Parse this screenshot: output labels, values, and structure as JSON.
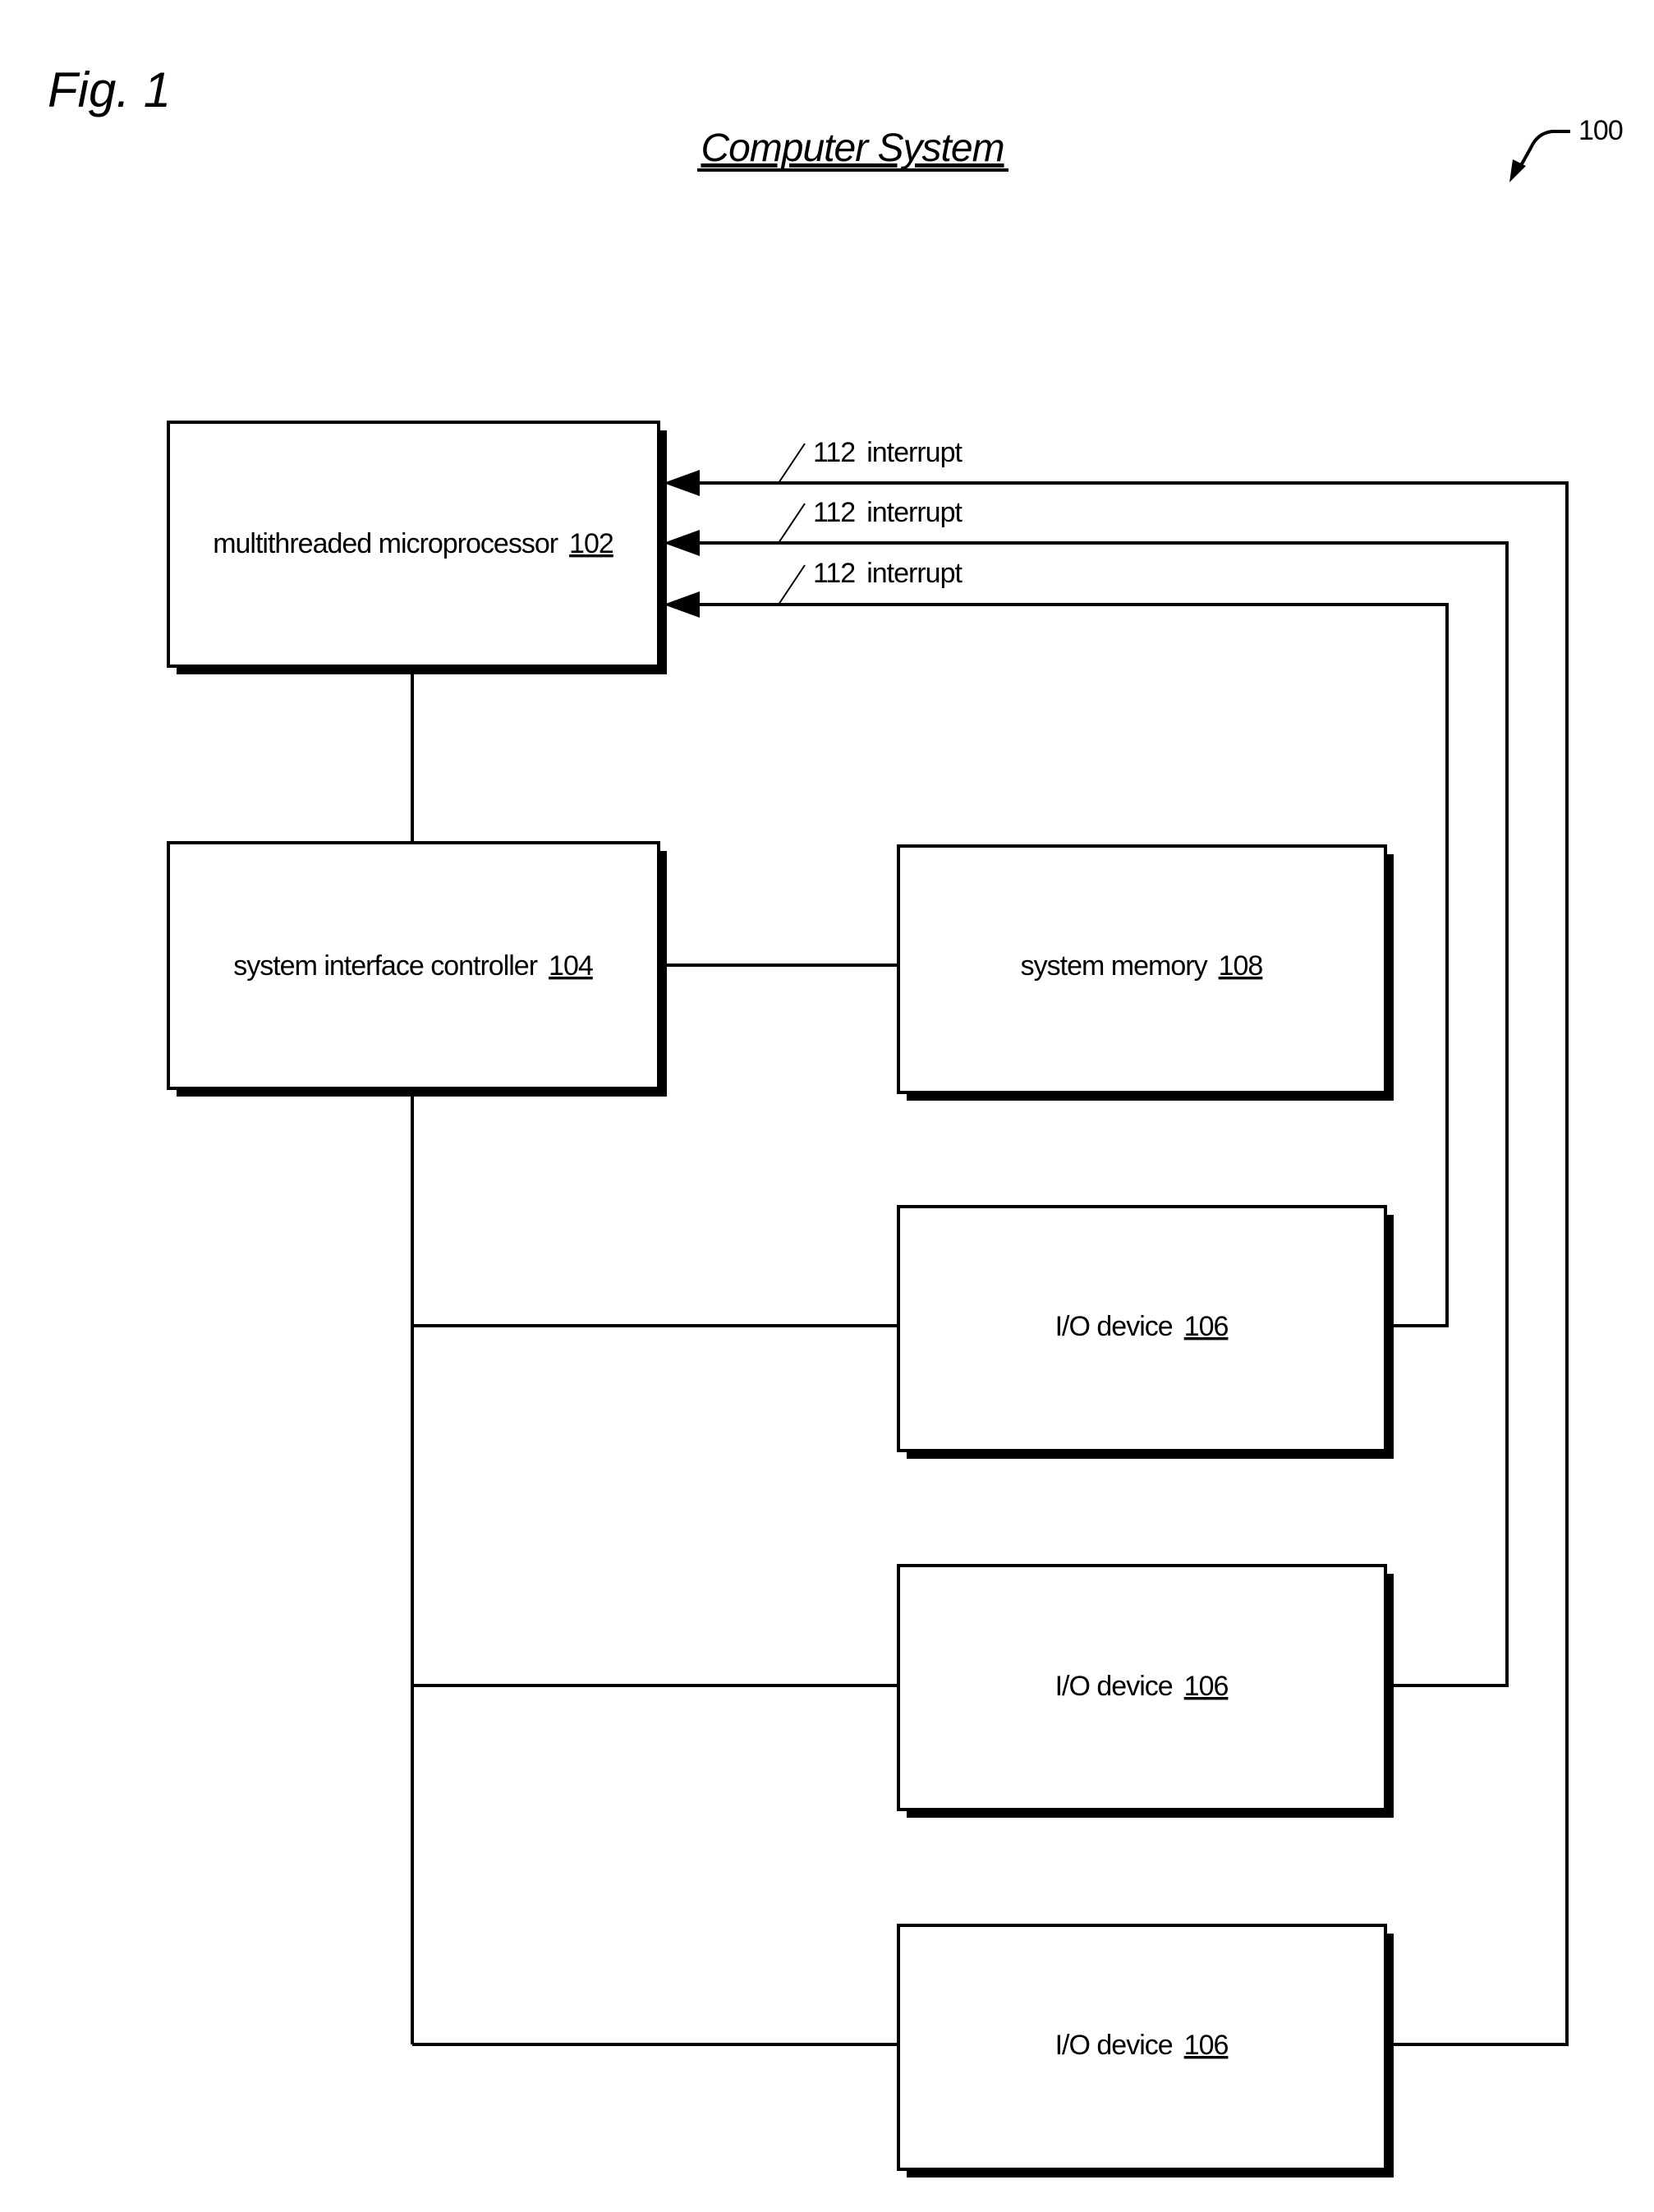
{
  "figure": {
    "label": "Fig. 1",
    "title": "Computer System",
    "ref": "100"
  },
  "blocks": [
    {
      "id": "microprocessor",
      "name": "multithreaded microprocessor",
      "ref": "102"
    },
    {
      "id": "controller",
      "name": "system interface controller",
      "ref": "104"
    },
    {
      "id": "memory",
      "name": "system memory",
      "ref": "108"
    },
    {
      "id": "io1",
      "name": "I/O device",
      "ref": "106"
    },
    {
      "id": "io2",
      "name": "I/O device",
      "ref": "106"
    },
    {
      "id": "io3",
      "name": "I/O device",
      "ref": "106"
    }
  ],
  "interrupts": [
    {
      "ref": "112",
      "label": "interrupt",
      "from": "io3"
    },
    {
      "ref": "112",
      "label": "interrupt",
      "from": "io2"
    },
    {
      "ref": "112",
      "label": "interrupt",
      "from": "io1"
    }
  ],
  "colors": {
    "line": "#000000",
    "background": "#ffffff"
  }
}
